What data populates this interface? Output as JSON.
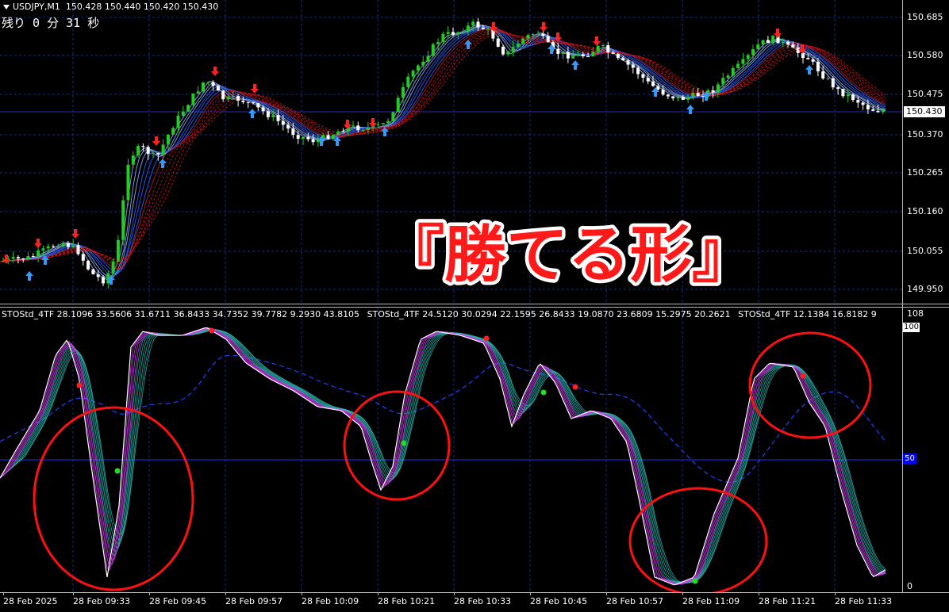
{
  "header": {
    "symbol": "USDJPY,M1",
    "prices": "150.428 150.440 150.420 150.430",
    "countdown": "残り 0 分 31 秒"
  },
  "overlay": {
    "text": "『勝てる形』",
    "fill": "#ff1a1a",
    "stroke": "#ffffff"
  },
  "price_axis": {
    "labels": [
      "150.685",
      "150.580",
      "150.475",
      "150.370",
      "150.265",
      "150.160",
      "150.055",
      "149.950"
    ],
    "current": "150.430"
  },
  "indicator": {
    "header_parts": [
      "STOStd_4TF 28.1096 33.5606 31.6711 36.8433 34.7352 39.7782 9.2930 43.8105",
      "STOStd_4TF 24.5120 30.0294 22.1595 26.8433 19.0870 23.6809 15.2975 20.2621",
      "STOStd_4TF 12.1384 16.8182 9"
    ],
    "axis_top": "108",
    "box_top": "100",
    "level": "50",
    "axis_bottom": "0"
  },
  "time_axis": {
    "labels": [
      "28 Feb 2025",
      "28 Feb 09:33",
      "28 Feb 09:45",
      "28 Feb 09:57",
      "28 Feb 10:09",
      "28 Feb 10:21",
      "28 Feb 10:33",
      "28 Feb 10:45",
      "28 Feb 10:57",
      "28 Feb 11:09",
      "28 Feb 11:21",
      "28 Feb 11:33"
    ]
  },
  "colors": {
    "grid": "#1a2c7a",
    "bull": "#22cc22",
    "bear": "#ffffff",
    "ribbon_up": "#2f60ff",
    "ribbon_down": "#d01010",
    "sto_main": "#ffffff",
    "sto_fast": "#e040ff",
    "sto_slow": "#2ab8b0",
    "circle": "#ff1010",
    "arrow_up": "#3399ff",
    "arrow_down": "#ff2020"
  }
}
